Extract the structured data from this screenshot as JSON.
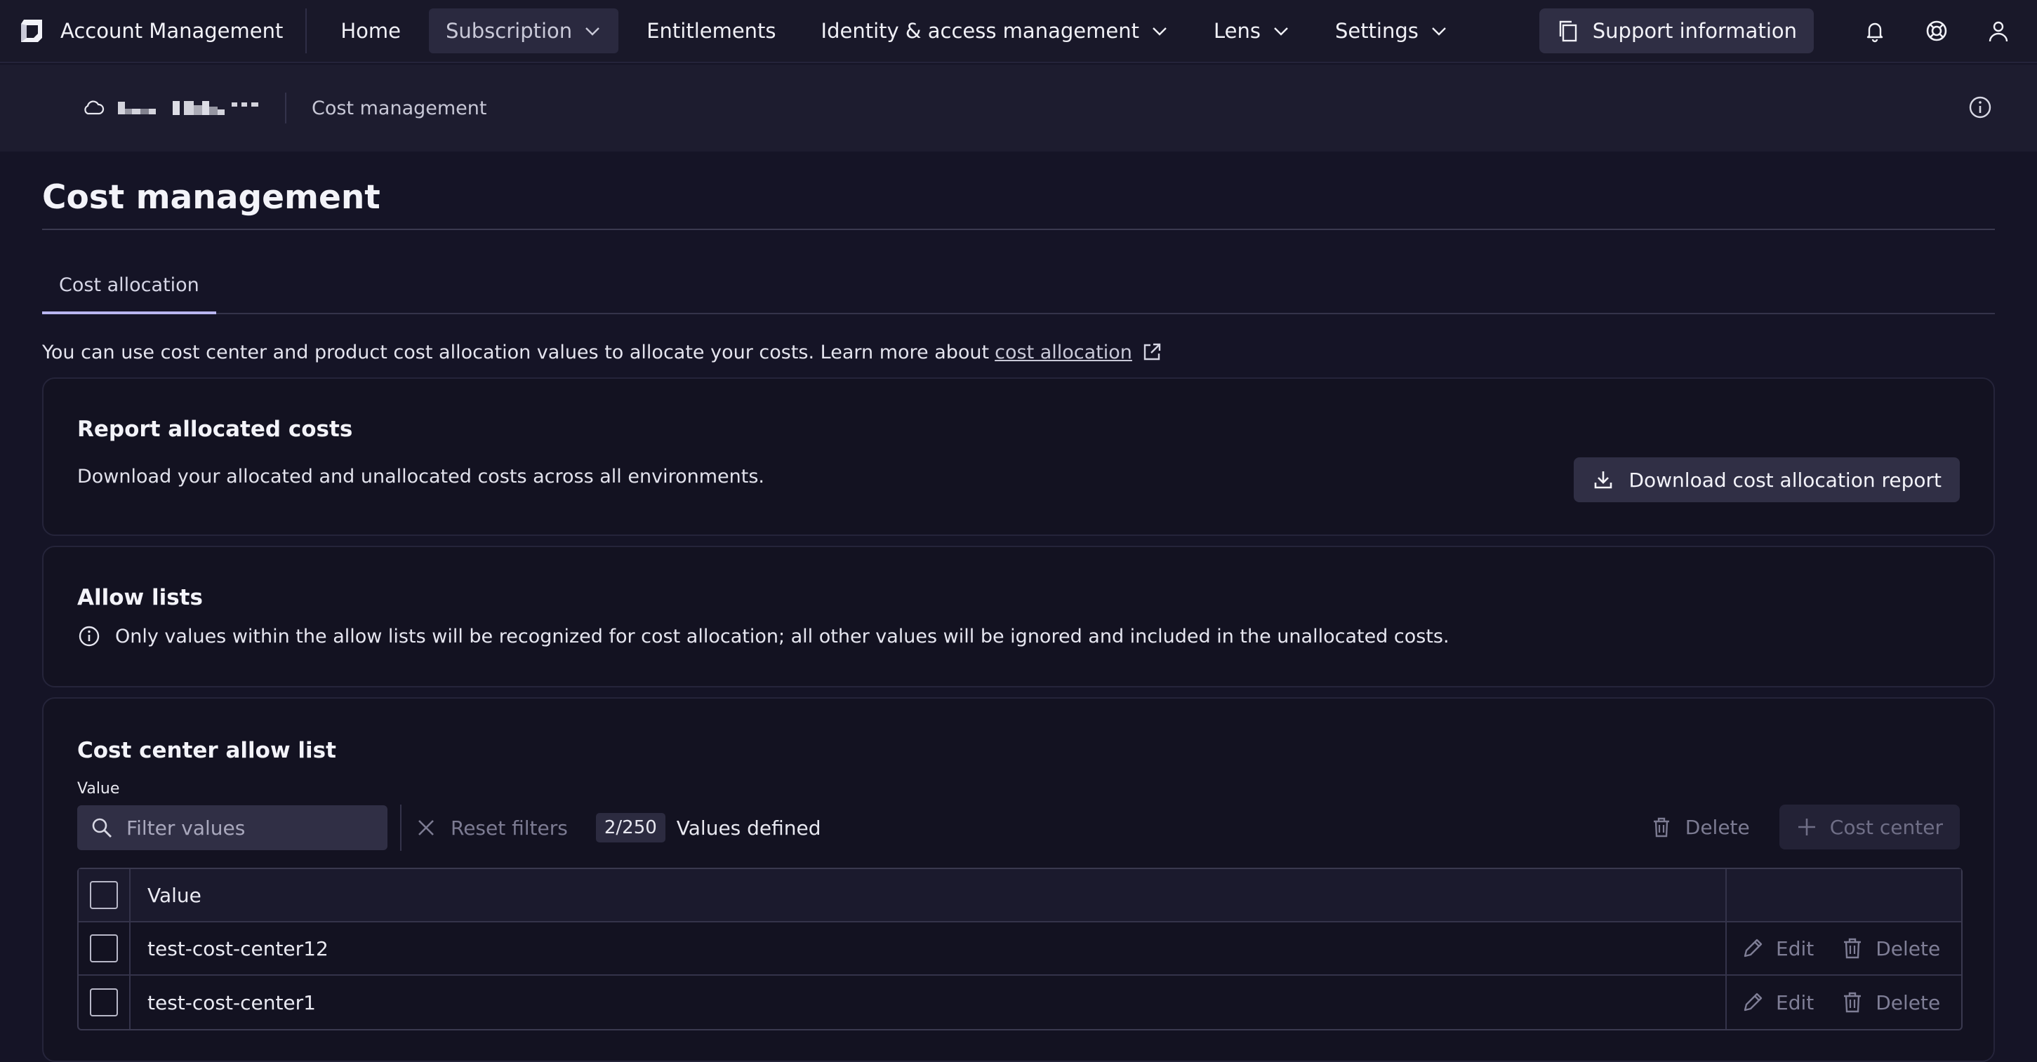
{
  "topnav": {
    "app_title": "Account Management",
    "items": [
      {
        "label": "Home",
        "dropdown": false,
        "active": false
      },
      {
        "label": "Subscription",
        "dropdown": true,
        "active": true
      },
      {
        "label": "Entitlements",
        "dropdown": false,
        "active": false
      },
      {
        "label": "Identity & access management",
        "dropdown": true,
        "active": false
      },
      {
        "label": "Lens",
        "dropdown": true,
        "active": false
      },
      {
        "label": "Settings",
        "dropdown": true,
        "active": false
      }
    ],
    "support_label": "Support information",
    "icons": [
      "bell-icon",
      "help-lifebuoy-icon",
      "user-icon"
    ]
  },
  "subheader": {
    "environment_icon": "cloud-icon",
    "breadcrumb": "Cost management"
  },
  "page": {
    "title": "Cost management",
    "tab": "Cost allocation",
    "intro_text": "You can use cost center and product cost allocation values to allocate your costs. Learn more about",
    "intro_link": "cost allocation"
  },
  "report": {
    "title": "Report allocated costs",
    "description": "Download your allocated and unallocated costs across all environments.",
    "button": "Download cost allocation report"
  },
  "allow_lists": {
    "title": "Allow lists",
    "note": "Only values within the allow lists will be recognized for cost allocation; all other values will be ignored and included in the unallocated costs."
  },
  "cost_center": {
    "title": "Cost center allow list",
    "field_label": "Value",
    "filter_placeholder": "Filter values",
    "reset_label": "Reset filters",
    "count": "2/250",
    "count_label": "Values defined",
    "delete_label": "Delete",
    "add_label": "Cost center",
    "table": {
      "header": "Value",
      "rows": [
        {
          "value": "test-cost-center12",
          "edit": "Edit",
          "delete": "Delete"
        },
        {
          "value": "test-cost-center1",
          "edit": "Edit",
          "delete": "Delete"
        }
      ]
    }
  },
  "colors": {
    "background": "#151426",
    "card": "#131221",
    "accent_tab": "#b9b6f0"
  }
}
